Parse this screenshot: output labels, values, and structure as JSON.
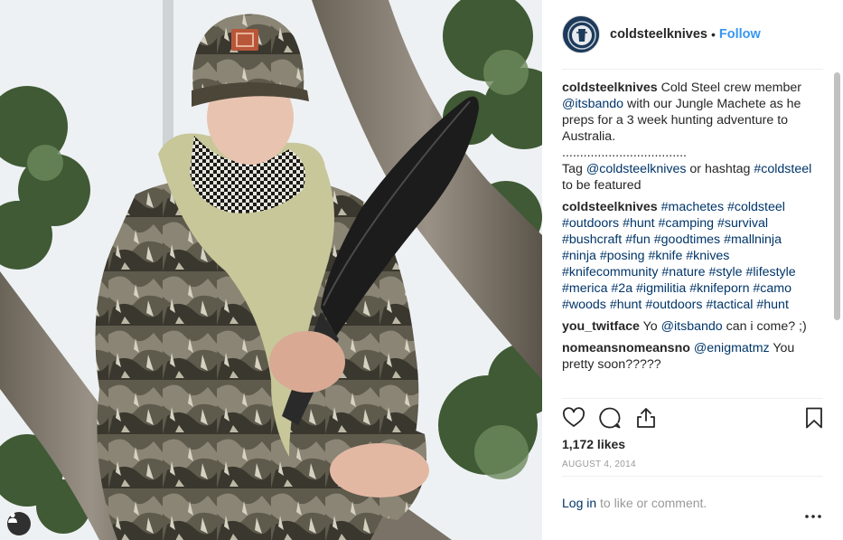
{
  "post": {
    "username": "coldsteelknives",
    "separator": "•",
    "follow_label": "Follow"
  },
  "icons": {
    "avatar": "coldsteel-logo",
    "tag": "person-tag-icon",
    "like": "heart-icon",
    "comment": "comment-bubble-icon",
    "share": "share-icon",
    "save": "bookmark-icon",
    "more": "more-options-icon"
  },
  "comments": [
    {
      "user": "coldsteelknives",
      "parts": [
        {
          "t": " Cold Steel crew member "
        },
        {
          "t": "@itsbando",
          "link": true
        },
        {
          "t": " with our Jungle Machete as he preps for a 3 week hunting adventure to Australia."
        }
      ],
      "extra_lines": [
        [
          {
            "t": "..................................."
          }
        ],
        [
          {
            "t": "Tag "
          },
          {
            "t": "@coldsteelknives",
            "link": true
          },
          {
            "t": " or hashtag "
          },
          {
            "t": "#coldsteel",
            "link": true
          },
          {
            "t": " to be featured"
          }
        ]
      ]
    },
    {
      "user": "coldsteelknives",
      "parts": [
        {
          "t": " "
        },
        {
          "t": "#machetes",
          "link": true
        },
        {
          "t": " "
        },
        {
          "t": "#coldsteel",
          "link": true
        },
        {
          "t": " "
        },
        {
          "t": "#outdoors",
          "link": true
        },
        {
          "t": " "
        },
        {
          "t": "#hunt",
          "link": true
        },
        {
          "t": " "
        },
        {
          "t": "#camping",
          "link": true
        },
        {
          "t": " "
        },
        {
          "t": "#survival",
          "link": true
        },
        {
          "t": " "
        },
        {
          "t": "#bushcraft",
          "link": true
        },
        {
          "t": " "
        },
        {
          "t": "#fun",
          "link": true
        },
        {
          "t": " "
        },
        {
          "t": "#goodtimes",
          "link": true
        },
        {
          "t": " "
        },
        {
          "t": "#mallninja",
          "link": true
        },
        {
          "t": " "
        },
        {
          "t": "#ninja",
          "link": true
        },
        {
          "t": " "
        },
        {
          "t": "#posing",
          "link": true
        },
        {
          "t": " "
        },
        {
          "t": "#knife",
          "link": true
        },
        {
          "t": " "
        },
        {
          "t": "#knives",
          "link": true
        },
        {
          "t": " "
        },
        {
          "t": "#knifecommunity",
          "link": true
        },
        {
          "t": " "
        },
        {
          "t": "#nature",
          "link": true
        },
        {
          "t": " "
        },
        {
          "t": "#style",
          "link": true
        },
        {
          "t": " "
        },
        {
          "t": "#lifestyle",
          "link": true
        },
        {
          "t": " "
        },
        {
          "t": "#merica",
          "link": true
        },
        {
          "t": " "
        },
        {
          "t": "#2a",
          "link": true
        },
        {
          "t": " "
        },
        {
          "t": "#igmilitia",
          "link": true
        },
        {
          "t": " "
        },
        {
          "t": "#knifeporn",
          "link": true
        },
        {
          "t": " "
        },
        {
          "t": "#camo",
          "link": true
        },
        {
          "t": " "
        },
        {
          "t": "#woods",
          "link": true
        },
        {
          "t": " "
        },
        {
          "t": "#hunt",
          "link": true
        },
        {
          "t": " "
        },
        {
          "t": "#outdoors",
          "link": true
        },
        {
          "t": " "
        },
        {
          "t": "#tactical",
          "link": true
        },
        {
          "t": " "
        },
        {
          "t": "#hunt",
          "link": true
        }
      ]
    },
    {
      "user": "you_twitface",
      "parts": [
        {
          "t": " Yo "
        },
        {
          "t": "@itsbando",
          "link": true
        },
        {
          "t": " can i come? ;)"
        }
      ]
    },
    {
      "user": "nomeansnomeansno",
      "parts": [
        {
          "t": " "
        },
        {
          "t": "@enigmatmz",
          "link": true
        },
        {
          "t": " You pretty soon?????"
        }
      ]
    }
  ],
  "likes": "1,172 likes",
  "date": "August 4, 2014",
  "login": {
    "link_text": "Log in",
    "rest_text": " to like or comment."
  }
}
